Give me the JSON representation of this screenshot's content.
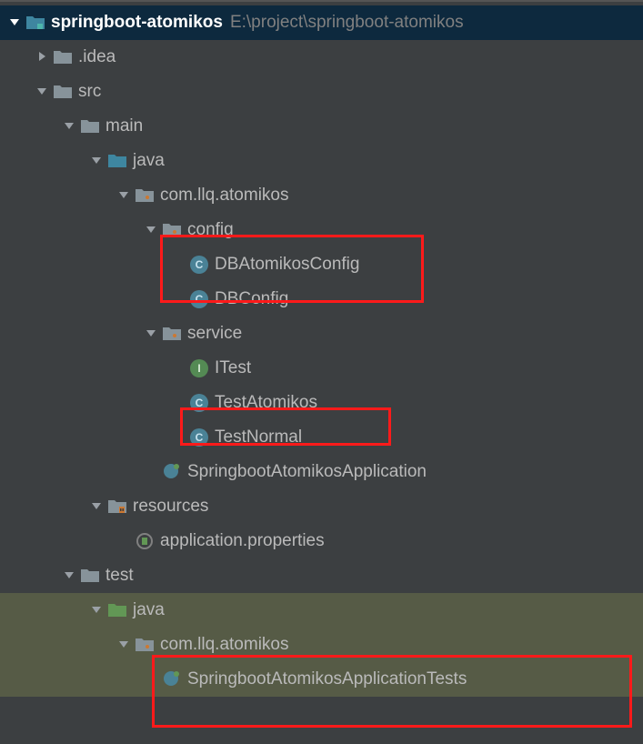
{
  "root": {
    "name": "springboot-atomikos",
    "path": "E:\\project\\springboot-atomikos"
  },
  "nodes": {
    "idea": ".idea",
    "src": "src",
    "main": "main",
    "java1": "java",
    "pkg1": "com.llq.atomikos",
    "config": "config",
    "dbAtomikosConfig": "DBAtomikosConfig",
    "dbConfig": "DBConfig",
    "service": "service",
    "itest": "ITest",
    "testAtomikos": "TestAtomikos",
    "testNormal": "TestNormal",
    "app": "SpringbootAtomikosApplication",
    "resources": "resources",
    "appProps": "application.properties",
    "test": "test",
    "java2": "java",
    "pkg2": "com.llq.atomikos",
    "appTests": "SpringbootAtomikosApplicationTests"
  }
}
